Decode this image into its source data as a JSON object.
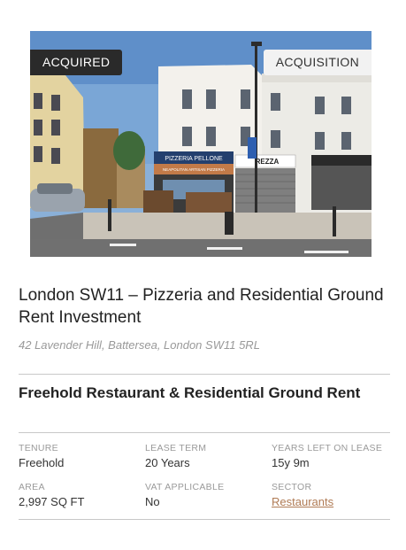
{
  "listing": {
    "badge_status": "ACQUIRED",
    "badge_type": "ACQUISITION",
    "title": "London SW11 – Pizzeria and Residential Ground Rent Investment",
    "address": "42 Lavender Hill, Battersea, London SW11 5RL",
    "subtitle": "Freehold Restaurant & Residential Ground Rent",
    "photo_signs": {
      "shop_name": "PIZZERIA PELLONE",
      "shop_tagline": "NEAPOLITAN ARTISAN PIZZERIA",
      "neighbour_sign": "REZZA"
    }
  },
  "specs": {
    "tenure": {
      "label": "TENURE",
      "value": "Freehold"
    },
    "lease_term": {
      "label": "LEASE TERM",
      "value": "20 Years"
    },
    "years_left": {
      "label": "YEARS LEFT ON LEASE",
      "value": "15y 9m"
    },
    "area": {
      "label": "AREA",
      "value": "2,997 SQ FT"
    },
    "vat": {
      "label": "VAT APPLICABLE",
      "value": "No"
    },
    "sector": {
      "label": "SECTOR",
      "value": "Restaurants"
    }
  },
  "colors": {
    "badge_dark": "#2a2a2a",
    "badge_light": "#f2f2f2",
    "link": "#b07b55",
    "label": "#9a9a9a"
  }
}
